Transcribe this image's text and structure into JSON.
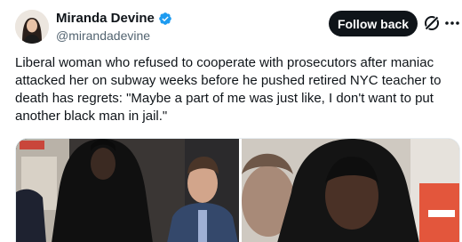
{
  "author": {
    "display_name": "Miranda Devine",
    "handle": "@mirandadevine",
    "verified": true,
    "verified_color": "#1d9bf0"
  },
  "actions": {
    "follow_label": "Follow back",
    "grok_icon": "grok-slash-icon",
    "more_icon": "more-horizontal-icon"
  },
  "tweet": {
    "text": "Liberal woman who refused to cooperate with prosecutors after maniac attacked her on subway weeks before he pushed retired NYC teacher to death has regrets: \"Maybe a part of me was just like, I don't want to put another black man in jail.\""
  },
  "media": {
    "count": 2
  },
  "colors": {
    "text": "#0f1419",
    "secondary": "#536471",
    "button_bg": "#0f1419"
  }
}
